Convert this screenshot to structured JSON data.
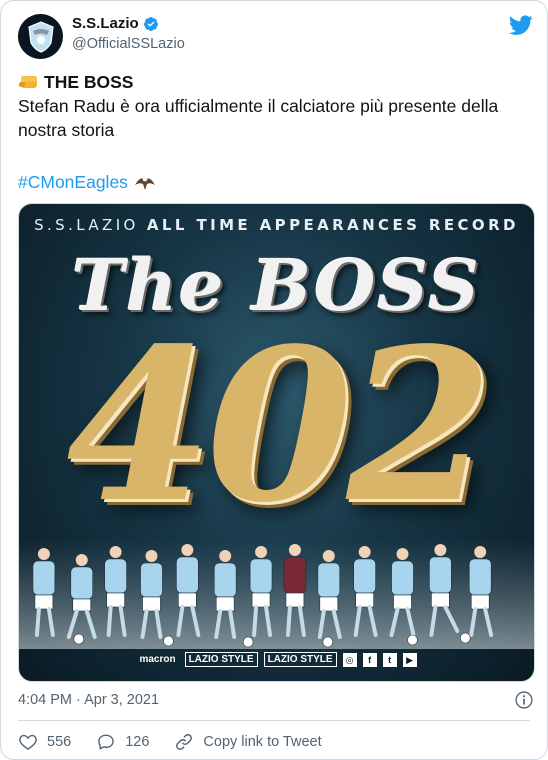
{
  "account": {
    "display_name": "S.S.Lazio",
    "handle": "@OfficialSSLazio"
  },
  "tweet": {
    "headline": "THE BOSS",
    "body": "Stefan Radu è ora ufficialmente il calciatore più presente della nostra storia",
    "hashtag": "#CMonEagles",
    "timestamp": "4:04 PM · Apr 3, 2021"
  },
  "media": {
    "title_prefix": "S.S.LAZIO",
    "title_bold": "ALL TIME APPEARANCES RECORD",
    "headline": "The BOSS",
    "number": "402",
    "sponsors": [
      "macron",
      "LAZIO STYLE",
      "LAZIO STYLE"
    ]
  },
  "actions": {
    "likes": "556",
    "replies": "126",
    "copy_link": "Copy link to Tweet"
  },
  "colors": {
    "accent": "#1d9bf0",
    "text": "#0f1419",
    "muted": "#536471",
    "border": "#cfd9de"
  }
}
